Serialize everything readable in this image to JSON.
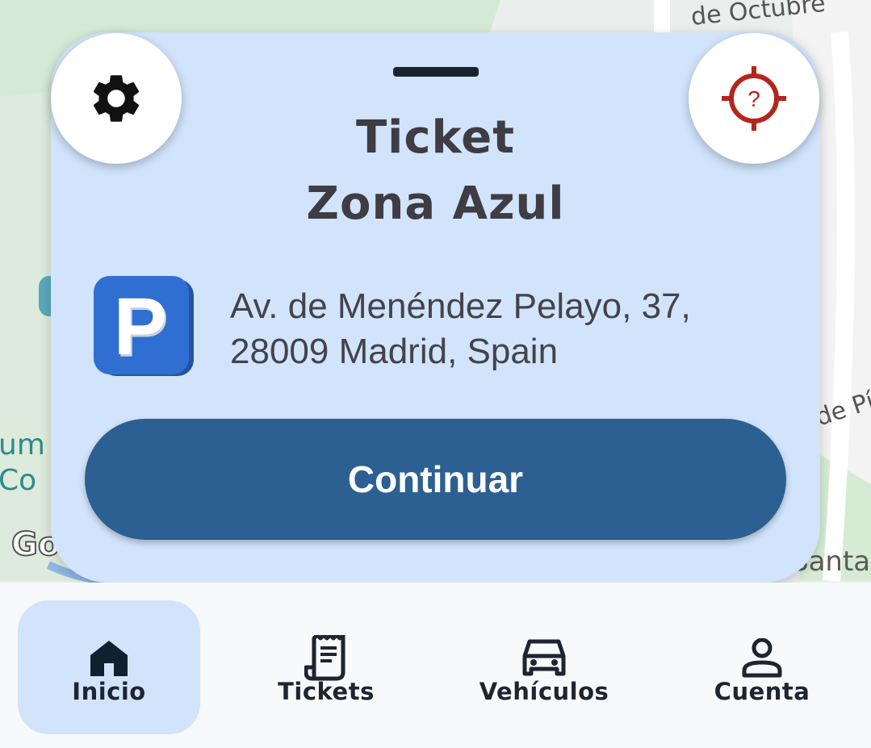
{
  "map": {
    "labels": {
      "octubre": "de Octubre",
      "dep": "de Pí",
      "santa": "Santa",
      "um_line1": "um",
      "um_line2": "Co",
      "google": "Go"
    }
  },
  "card": {
    "title_line1": "Ticket",
    "title_line2": "Zona Azul",
    "address_line1": "Av. de Menéndez Pelayo, 37,",
    "address_line2": "28009 Madrid, Spain",
    "parking_icon_letter": "P",
    "continue_label": "Continuar",
    "locate_icon_glyph": "?"
  },
  "nav": {
    "items": [
      {
        "label": "Inicio",
        "icon": "home-icon",
        "active": true
      },
      {
        "label": "Tickets",
        "icon": "receipt-icon",
        "active": false
      },
      {
        "label": "Vehículos",
        "icon": "car-icon",
        "active": false
      },
      {
        "label": "Cuenta",
        "icon": "person-icon",
        "active": false
      }
    ]
  },
  "colors": {
    "card_bg": "#d1e4fb",
    "primary_button": "#2c6092",
    "locate_icon": "#b3261e",
    "parking_icon": "#2f6fd2",
    "nav_active_bg": "#d1e4fb"
  }
}
